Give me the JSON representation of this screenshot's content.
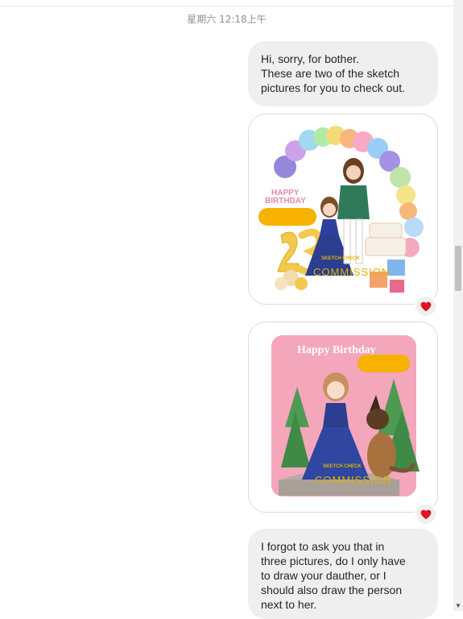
{
  "chat": {
    "timestamp": "星期六 12:18上午",
    "message1_lines": [
      "Hi, sorry, for bother.",
      "These are two of the sketch",
      "pictures for you to check out."
    ],
    "image1": {
      "banner_text": "HAPPY BIRTHDAY",
      "watermark_top": "SKETCH CHECK",
      "watermark_main": "COMMISSION"
    },
    "image2": {
      "banner_text": "Happy Birthday",
      "watermark_top": "SKETCH CHECK",
      "watermark_main": "COMMISSION"
    },
    "message2_lines": [
      "I forgot to ask you that in",
      "three pictures, do I only have",
      "to draw your dauther, or I",
      "should also draw the person",
      "next to her."
    ],
    "reactions": {
      "image1": "heart-reaction",
      "image2": "heart-reaction"
    }
  },
  "colors": {
    "bubble": "#efefef",
    "heart": "#e0151f",
    "timestamp": "#8e8e8e"
  }
}
